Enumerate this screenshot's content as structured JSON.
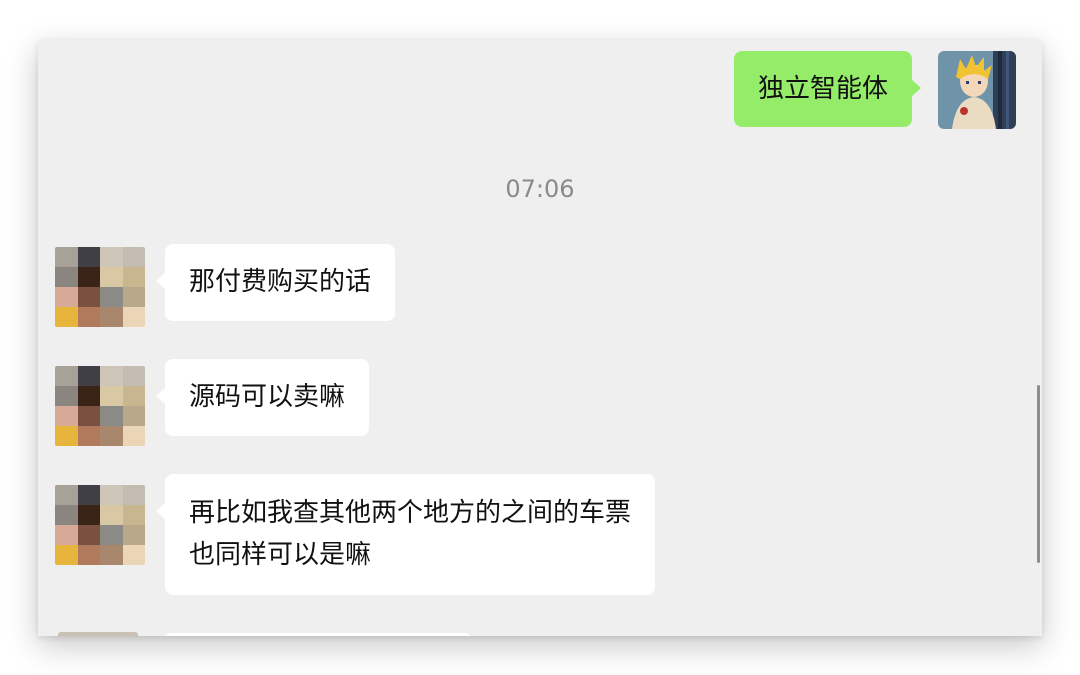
{
  "chat": {
    "messages": [
      {
        "sender": "self",
        "text": "独立智能体"
      },
      {
        "sender": "other",
        "text": "那付费购买的话"
      },
      {
        "sender": "other",
        "text": "源码可以卖嘛"
      },
      {
        "sender": "other",
        "lines": [
          "再比如我查其他两个地方的之间的车票",
          "也同样可以是嘛"
        ]
      }
    ],
    "timestamp": "07:06"
  },
  "colors": {
    "window_bg": "#efefef",
    "self_bubble": "#95ec69",
    "other_bubble": "#ffffff",
    "timestamp_text": "#8a8a8a"
  },
  "icons": {
    "self_avatar": "anime-character-avatar",
    "other_avatar": "pixelated-mosaic-avatar"
  }
}
